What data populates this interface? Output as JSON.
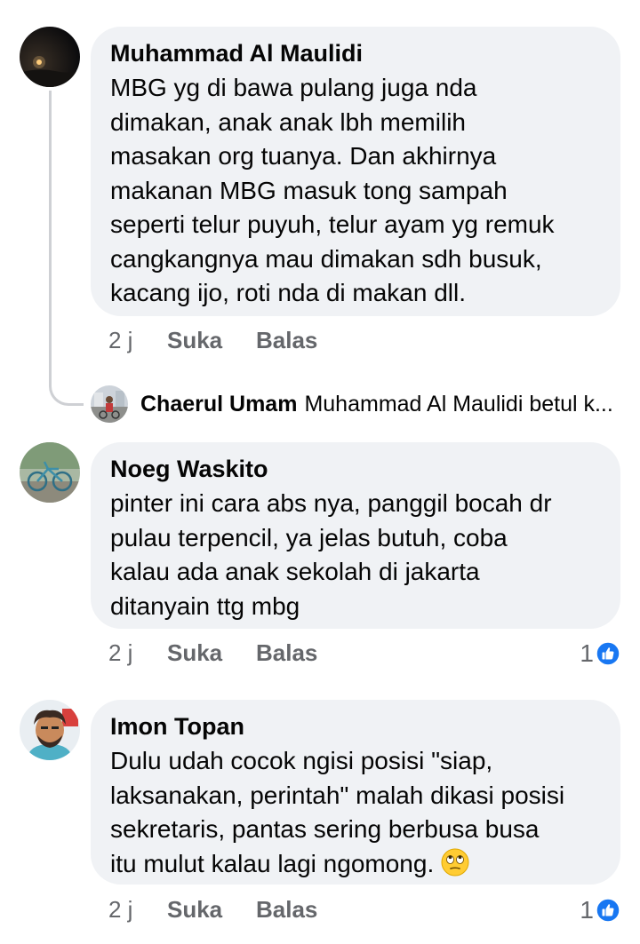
{
  "comments": [
    {
      "author": "Muhammad Al Maulidi",
      "text": "MBG yg di bawa pulang juga nda\ndimakan, anak anak lbh memilih\nmasakan org tuanya. Dan akhirnya\nmakanan MBG masuk tong sampah\nseperti telur puyuh, telur ayam yg remuk\ncangkangnya mau dimakan sdh busuk,\nkacang ijo, roti nda di makan dll.",
      "time": "2 j",
      "like_label": "Suka",
      "reply_label": "Balas",
      "avatar_icon": "night-sky-avatar-icon"
    },
    {
      "author": "Noeg Waskito",
      "text": "pinter ini cara abs nya, panggil bocah dr\npulau terpencil, ya jelas butuh, coba\nkalau ada anak sekolah di jakarta\nditanyain ttg mbg",
      "time": "2 j",
      "like_label": "Suka",
      "reply_label": "Balas",
      "reaction_count": "1",
      "avatar_icon": "bicycle-avatar-icon"
    },
    {
      "author": "Imon Topan",
      "text": "Dulu udah cocok ngisi posisi \"siap,\nlaksanakan, perintah\" malah dikasi posisi\nsekretaris, pantas sering berbusa busa\nitu mulut kalau lagi ngomong.",
      "time": "2 j",
      "like_label": "Suka",
      "reply_label": "Balas",
      "reaction_count": "1",
      "avatar_icon": "cartoon-face-avatar-icon",
      "emoji": "eye-roll-emoji"
    }
  ],
  "reply_preview": {
    "author": "Chaerul Umam",
    "text": "Muhammad Al Maulidi betul k..."
  },
  "colors": {
    "bubble": "#f0f2f5",
    "secondary_text": "#65676b",
    "like_blue": "#1877f2",
    "thread_line": "#ced0d4"
  }
}
